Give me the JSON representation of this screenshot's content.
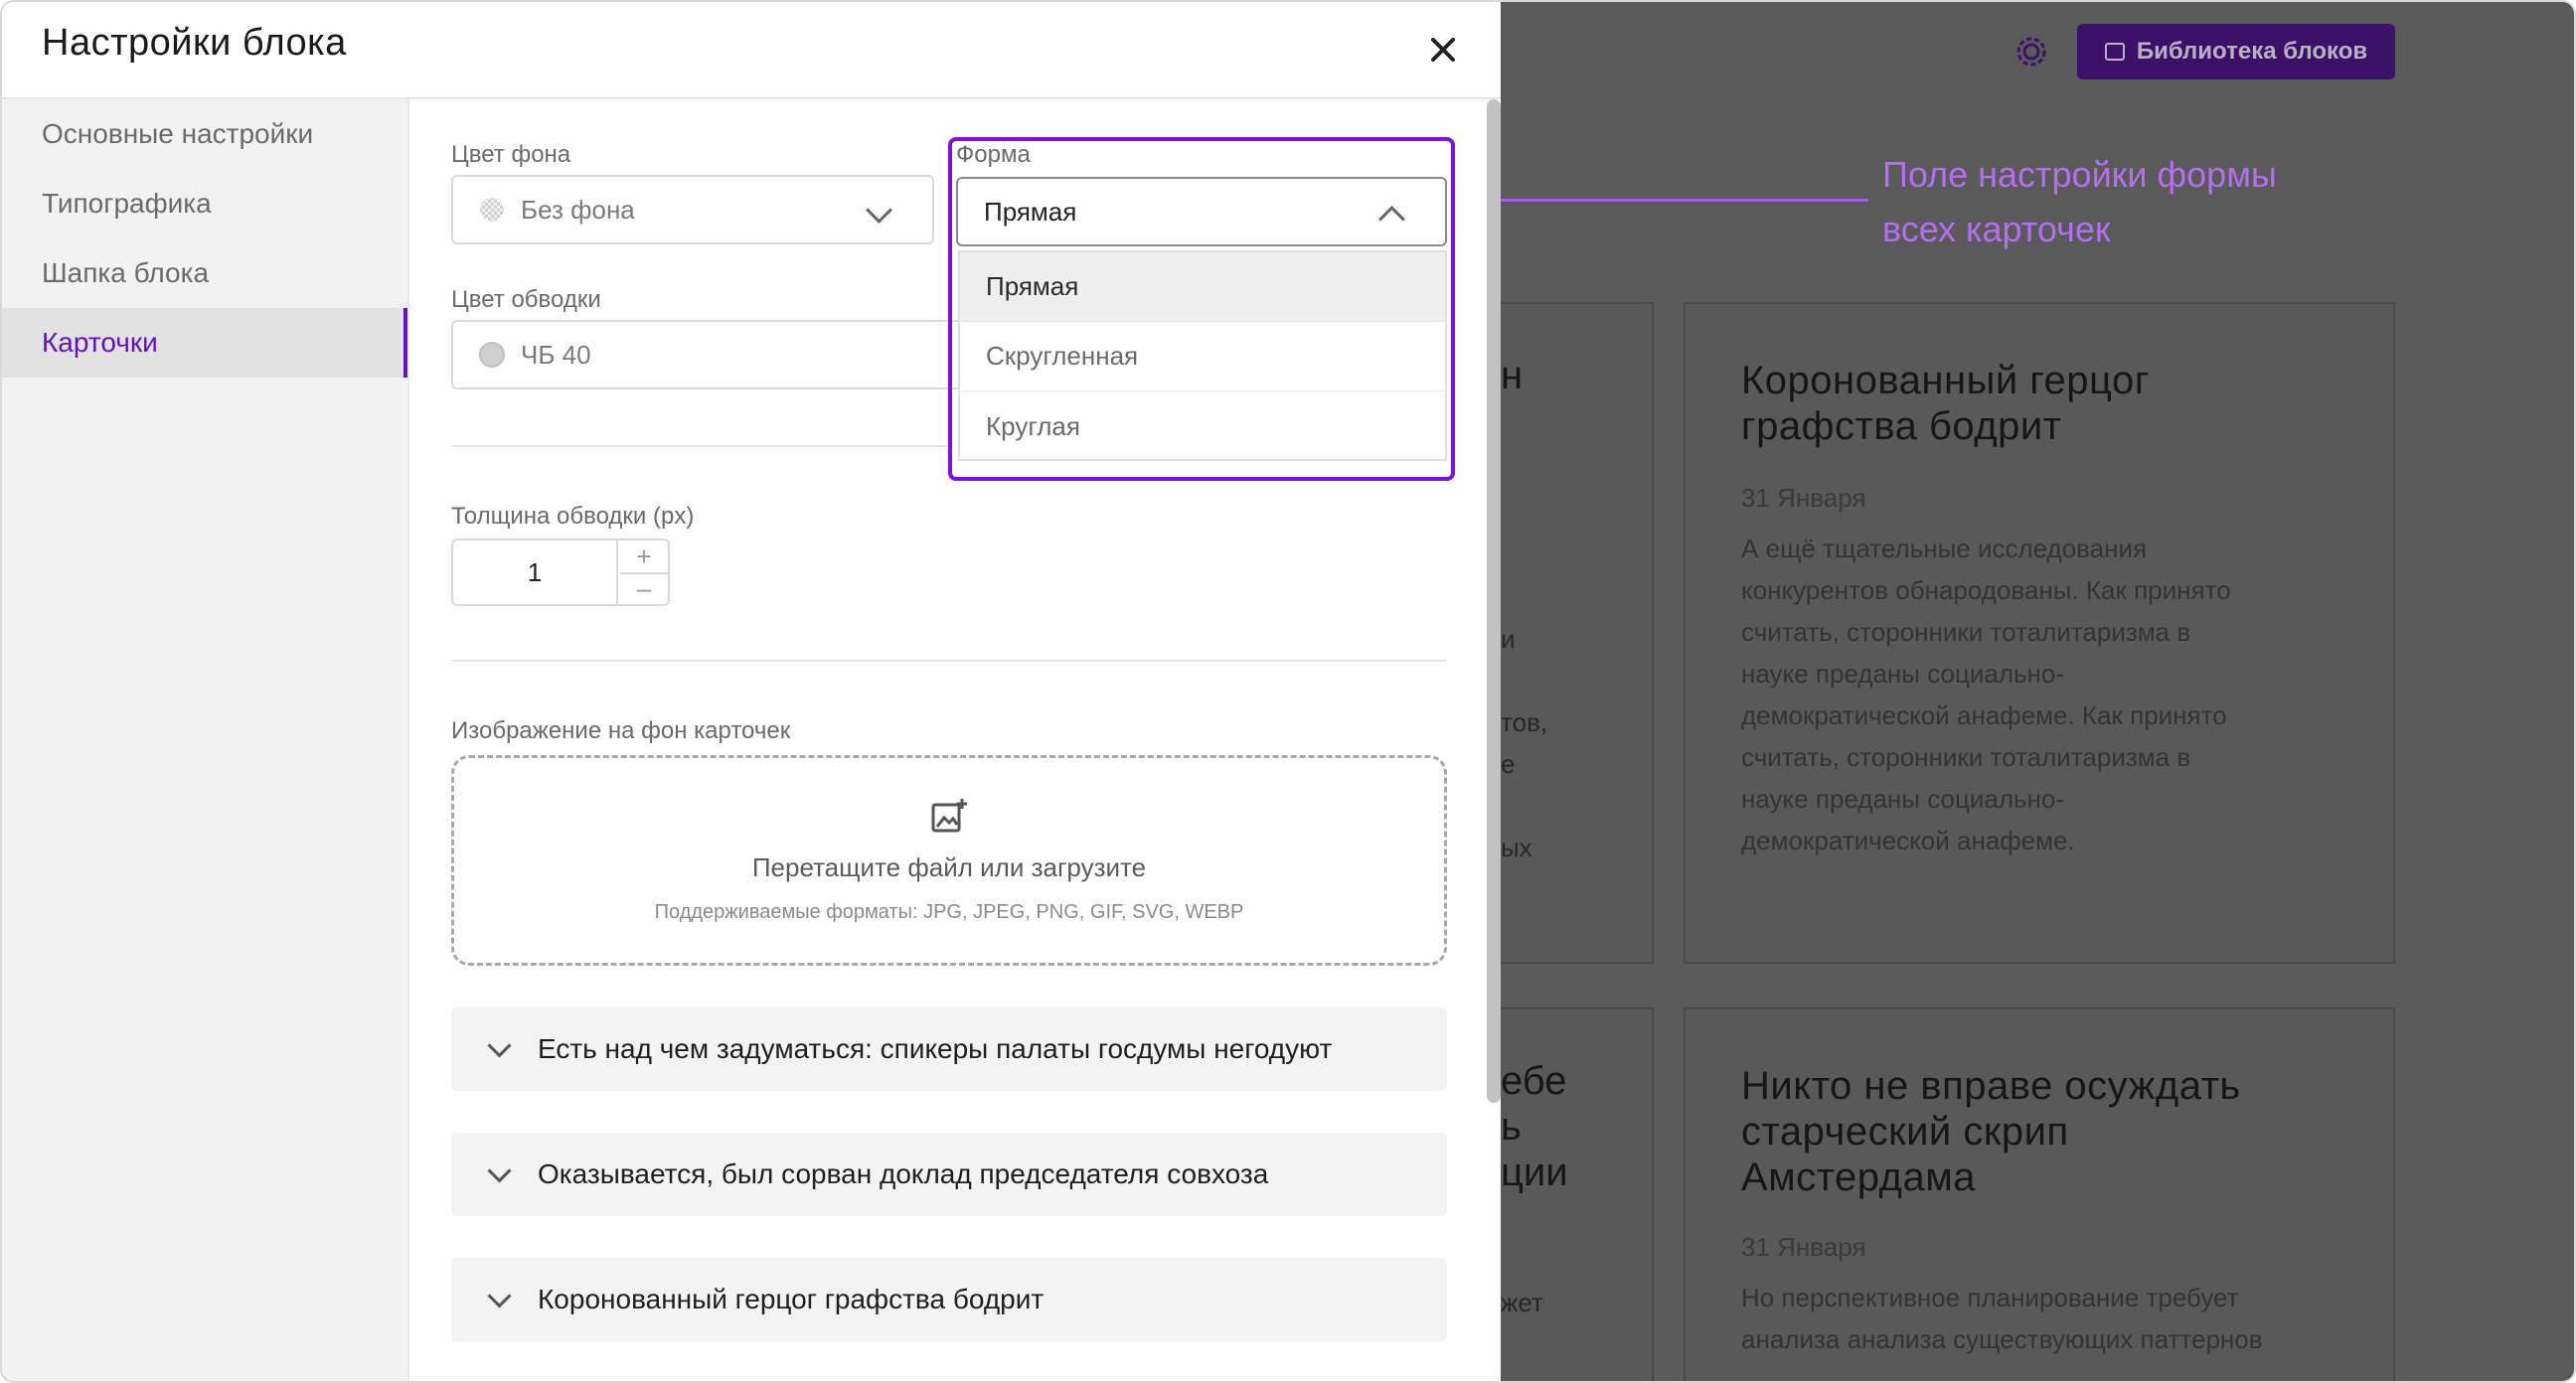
{
  "modal": {
    "title": "Настройки блока",
    "sidebar": [
      {
        "label": "Основные настройки",
        "active": false
      },
      {
        "label": "Типографика",
        "active": false
      },
      {
        "label": "Шапка блока",
        "active": false
      },
      {
        "label": "Карточки",
        "active": true
      }
    ],
    "bg_color": {
      "label": "Цвет фона",
      "value": "Без фона"
    },
    "border_color": {
      "label": "Цвет обводки",
      "value": "ЧБ 40",
      "swatch": "#cfcfcf"
    },
    "shape": {
      "label": "Форма",
      "value": "Прямая",
      "options": [
        "Прямая",
        "Скругленная",
        "Круглая"
      ]
    },
    "border_width": {
      "label": "Толщина обводки (px)",
      "value": "1",
      "plus": "+",
      "minus": "–"
    },
    "image": {
      "label": "Изображение на фон карточек",
      "main": "Перетащите файл или загрузите",
      "formats": "Поддерживаемые форматы: JPG, JPEG, PNG, GIF, SVG, WEBP"
    },
    "accordions": [
      "Есть над чем задуматься: спикеры палаты госдумы негодуют",
      "Оказывается, был сорван доклад председателя совхоза",
      "Коронованный герцог графства бодрит"
    ]
  },
  "annotation": {
    "line1": "Поле настройки формы",
    "line2": "всех карточек"
  },
  "background_page": {
    "library_button": "Библиотека блоков",
    "card1": {
      "title_l1": "Коронованный герцог",
      "title_l2": "графства бодрит",
      "date": "31 Января",
      "text": [
        "А ещё тщательные исследования",
        "конкурентов обнародованы. Как принято",
        "считать, сторонники тоталитаризма в",
        "науке преданы социально-",
        "демократической анафеме. Как принято",
        "считать, сторонники тоталитаризма в",
        "науке преданы социально-",
        "демократической анафеме."
      ]
    },
    "card2": {
      "title_l1": "Никто не вправе осуждать",
      "title_l2": "старческий скрип",
      "title_l3": "Амстердама",
      "date": "31 Января",
      "text": [
        "Но перспективное планирование требует",
        "анализа анализа существующих паттернов"
      ]
    },
    "fragments": [
      "н",
      "и",
      "тов,",
      "е",
      "ых",
      "ебе",
      "ь",
      "ции",
      "жет"
    ]
  },
  "colors": {
    "accent": "#6312c2",
    "annotation": "#b36ff0",
    "library_button_bg": "#3b1068"
  }
}
